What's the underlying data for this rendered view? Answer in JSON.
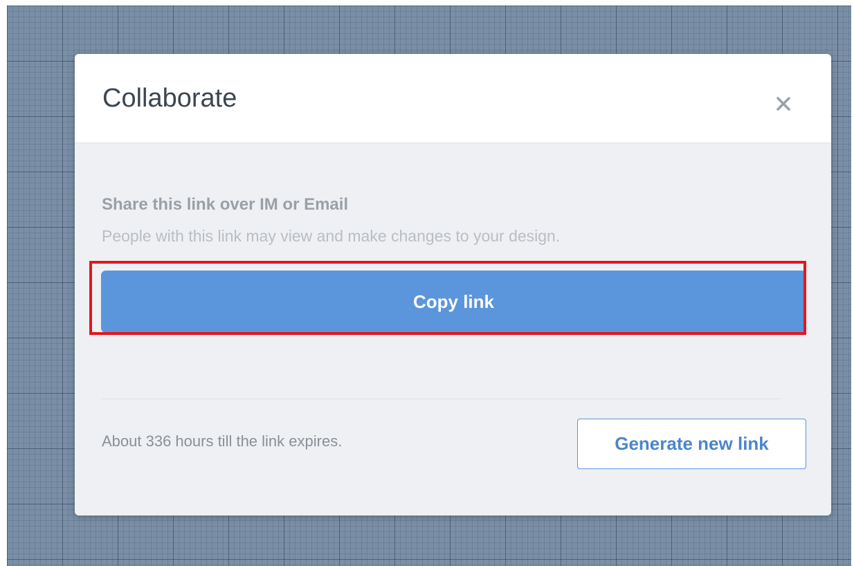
{
  "dialog": {
    "title": "Collaborate",
    "close_icon": "close-icon"
  },
  "share": {
    "heading": "Share this link over IM or Email",
    "description": "People with this link may view and make changes to your design."
  },
  "copy_button": {
    "label": "Copy link"
  },
  "footer": {
    "expiry_text": "About 336 hours till the link expires.",
    "generate_button_label": "Generate new link"
  },
  "colors": {
    "accent": "#5b95dc",
    "highlight": "#e8141b",
    "canvas": "#7a8fa6"
  }
}
